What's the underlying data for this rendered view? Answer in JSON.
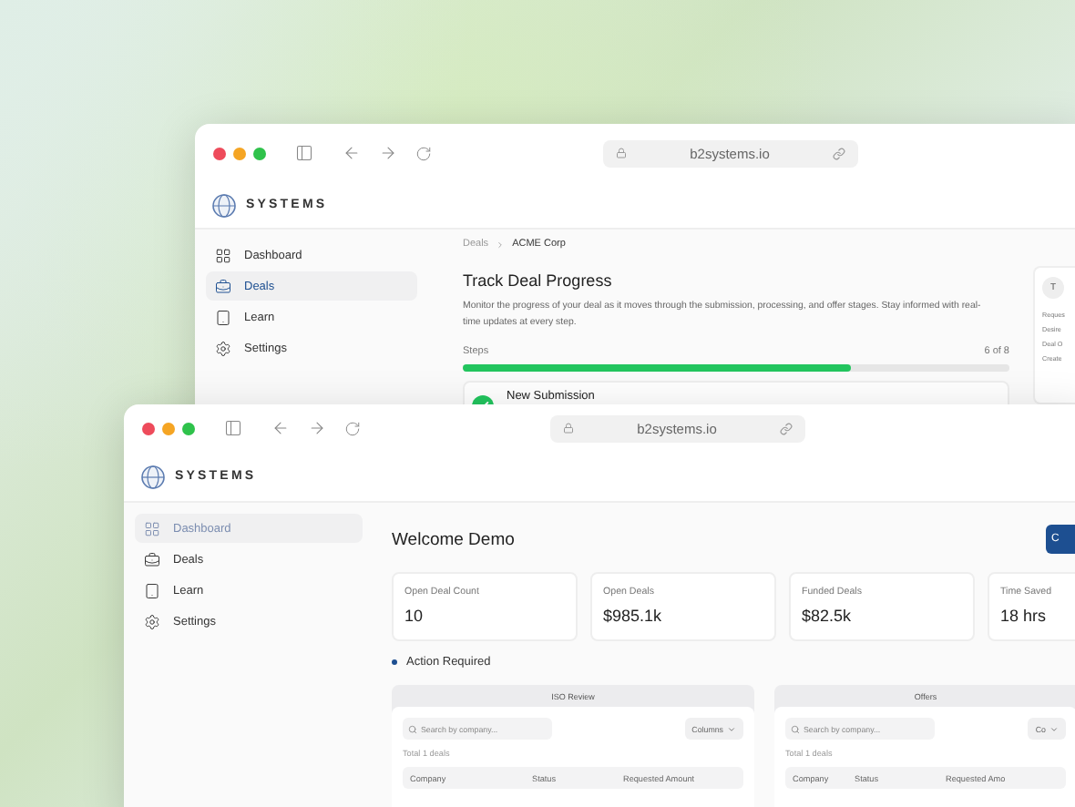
{
  "back_window": {
    "url": "b2systems.io",
    "brand": "SYSTEMS",
    "sidebar": [
      {
        "label": "Dashboard",
        "kind": "grid",
        "selected": false
      },
      {
        "label": "Deals",
        "kind": "deals",
        "selected": true
      },
      {
        "label": "Learn",
        "kind": "learn",
        "selected": false
      },
      {
        "label": "Settings",
        "kind": "settings",
        "selected": false
      }
    ],
    "breadcrumb": [
      "Deals",
      "ACME Corp"
    ],
    "title": "Track Deal Progress",
    "description": "Monitor the progress of your deal as it moves through the submission, processing, and offer stages. Stay informed with real-time updates at every step.",
    "steps": {
      "label": "Steps",
      "count": "6 of 8",
      "level": 0.71
    },
    "current_step": {
      "title": "New Submission",
      "done": true
    },
    "side_card": {
      "avatar": "T",
      "rows": [
        "Reques",
        "Desire",
        "Deal O",
        "Create"
      ]
    }
  },
  "front_window": {
    "url": "b2systems.io",
    "brand": "SYSTEMS",
    "sidebar": [
      {
        "label": "Dashboard",
        "kind": "grid",
        "selected": true
      },
      {
        "label": "Deals",
        "kind": "deals",
        "selected": false
      },
      {
        "label": "Learn",
        "kind": "learn",
        "selected": false
      },
      {
        "label": "Settings",
        "kind": "settings",
        "selected": false
      }
    ],
    "heading": "Welcome Demo",
    "action_button": "C",
    "stats": [
      {
        "label": "Open Deal Count",
        "value": "10"
      },
      {
        "label": "Open Deals",
        "value": "$985.1k"
      },
      {
        "label": "Funded Deals",
        "value": "$82.5k"
      },
      {
        "label": "Time Saved",
        "value": "18 hrs"
      }
    ],
    "section": "Action Required",
    "panels": [
      {
        "title": "ISO Review",
        "search_placeholder": "Search by company...",
        "columns_button": "Columns",
        "total": "Total 1 deals",
        "columns": [
          "Company",
          "Status",
          "Requested Amount"
        ]
      },
      {
        "title": "Offers",
        "search_placeholder": "Search by company...",
        "columns_button": "Co",
        "total": "Total 1 deals",
        "columns": [
          "Company",
          "Status",
          "Requested Amo"
        ]
      }
    ]
  }
}
